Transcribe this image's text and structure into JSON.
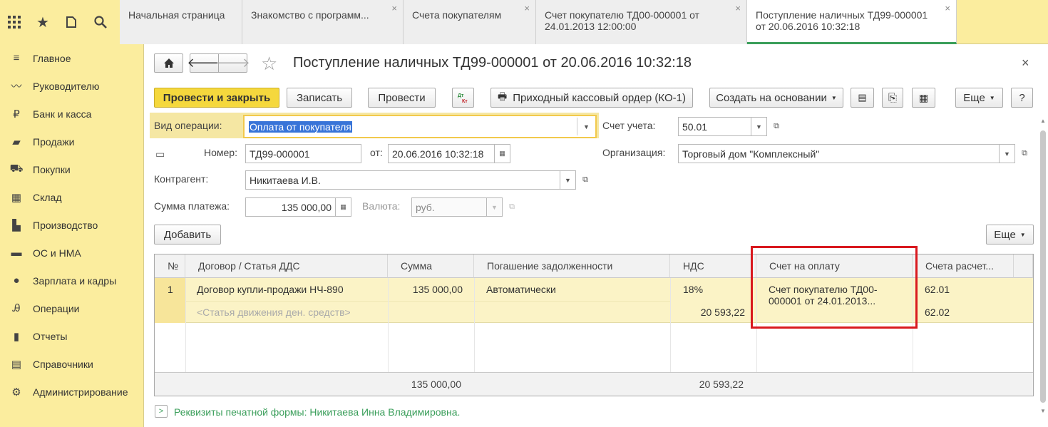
{
  "tabs": [
    {
      "label": "Начальная страница"
    },
    {
      "label": "Знакомство с программ..."
    },
    {
      "label": "Счета покупателям"
    },
    {
      "label": "Счет покупателю ТД00-000001 от 24.01.2013 12:00:00"
    },
    {
      "label": "Поступление наличных ТД99-000001 от 20.06.2016 10:32:18"
    }
  ],
  "sidebar": {
    "items": [
      {
        "label": "Главное",
        "icon": "menu-icon"
      },
      {
        "label": "Руководителю",
        "icon": "trend-icon"
      },
      {
        "label": "Банк и касса",
        "icon": "ruble-icon"
      },
      {
        "label": "Продажи",
        "icon": "bag-icon"
      },
      {
        "label": "Покупки",
        "icon": "cart-icon"
      },
      {
        "label": "Склад",
        "icon": "warehouse-icon"
      },
      {
        "label": "Производство",
        "icon": "factory-icon"
      },
      {
        "label": "ОС и НМА",
        "icon": "truck-icon"
      },
      {
        "label": "Зарплата и кадры",
        "icon": "person-icon"
      },
      {
        "label": "Операции",
        "icon": "operations-icon"
      },
      {
        "label": "Отчеты",
        "icon": "chart-icon"
      },
      {
        "label": "Справочники",
        "icon": "book-icon"
      },
      {
        "label": "Администрирование",
        "icon": "gear-icon"
      }
    ]
  },
  "doc": {
    "title": "Поступление наличных ТД99-000001 от 20.06.2016 10:32:18"
  },
  "toolbar": {
    "post_close": "Провести и закрыть",
    "write": "Записать",
    "post": "Провести",
    "pko": "Приходный кассовый ордер (КО-1)",
    "create_based": "Создать на основании",
    "more": "Еще",
    "help": "?"
  },
  "form": {
    "op_type_label": "Вид операции:",
    "op_type_value": "Оплата от покупателя",
    "account_label": "Счет учета:",
    "account_value": "50.01",
    "number_label": "Номер:",
    "number_value": "ТД99-000001",
    "date_label": "от:",
    "date_value": "20.06.2016 10:32:18",
    "org_label": "Организация:",
    "org_value": "Торговый дом \"Комплексный\"",
    "contractor_label": "Контрагент:",
    "contractor_value": "Никитаева И.В.",
    "sum_label": "Сумма платежа:",
    "sum_value": "135 000,00",
    "currency_label": "Валюта:",
    "currency_value": "руб."
  },
  "table": {
    "add_label": "Добавить",
    "more_label": "Еще",
    "headers": [
      "№",
      "Договор / Статья ДДС",
      "Сумма",
      "Погашение задолженности",
      "НДС",
      "Счет на оплату",
      "Счета расчет..."
    ],
    "row": {
      "num": "1",
      "contract": "Договор купли-продажи НЧ-890",
      "dds": "<Статья движения ден. средств>",
      "sum": "135 000,00",
      "repay": "Автоматически",
      "vat_rate": "18%",
      "vat_sum": "20 593,22",
      "invoice": "Счет покупателю ТД00-000001 от 24.01.2013...",
      "acc1": "62.01",
      "acc2": "62.02"
    },
    "footer": {
      "sum": "135 000,00",
      "vat": "20 593,22"
    }
  },
  "print_form": "Реквизиты печатной формы: Никитаева Инна Владимировна.",
  "colors": {
    "accent_green": "#3a9e5a",
    "highlight_red": "#d9191f",
    "panel_yellow": "#fbed9e"
  }
}
